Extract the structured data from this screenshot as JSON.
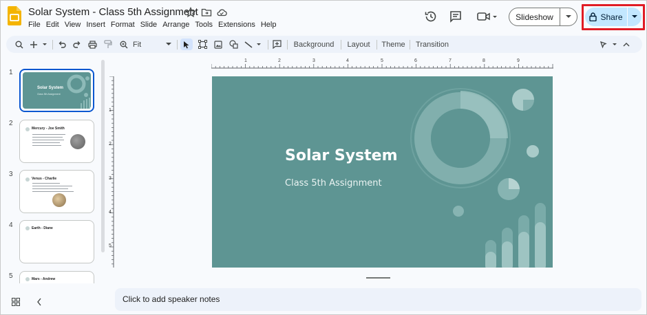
{
  "header": {
    "doc_title": "Solar System - Class  5th Assignment",
    "menu": [
      "File",
      "Edit",
      "View",
      "Insert",
      "Format",
      "Slide",
      "Arrange",
      "Tools",
      "Extensions",
      "Help"
    ],
    "slideshow_label": "Slideshow",
    "share_label": "Share",
    "icons": [
      "star-icon",
      "move-to-folder-icon",
      "cloud-status-icon",
      "version-history-icon",
      "comments-icon",
      "meet-icon"
    ]
  },
  "toolbar": {
    "zoom_value": "Fit",
    "background_label": "Background",
    "layout_label": "Layout",
    "theme_label": "Theme",
    "transition_label": "Transition"
  },
  "ruler": {
    "horizontal": [
      "1",
      "2",
      "3",
      "4",
      "5",
      "6",
      "7",
      "8",
      "9"
    ],
    "vertical": [
      "1",
      "2",
      "3",
      "4",
      "5"
    ]
  },
  "filmstrip": {
    "slides": [
      {
        "number": "1",
        "title": "Solar System",
        "subtitle": "Class 5th Assignment"
      },
      {
        "number": "2",
        "title": "Mercury - Joe Smith"
      },
      {
        "number": "3",
        "title": "Venus - Charlie"
      },
      {
        "number": "4",
        "title": "Earth - Diane"
      },
      {
        "number": "5",
        "title": "Mars - Andrew"
      }
    ]
  },
  "slide": {
    "title": "Solar System",
    "subtitle": "Class 5th Assignment"
  },
  "notes": {
    "placeholder": "Click to add speaker notes"
  },
  "colors": {
    "slide_background": "#5e9593",
    "share_button": "#c2e7ff",
    "highlight_box": "#e01b24",
    "toolbar_bg": "#edf2fa"
  }
}
